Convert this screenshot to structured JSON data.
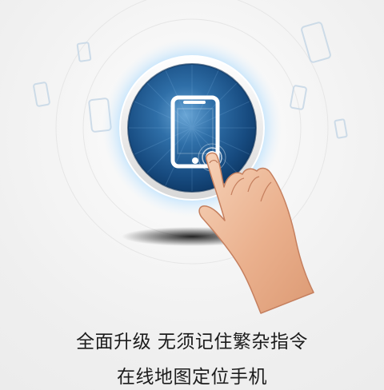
{
  "caption": {
    "line1": "全面升级 无须记住繁杂指令",
    "line2": "在线地图定位手机"
  },
  "colors": {
    "background": "#efefef",
    "glow": "#5fb8ff",
    "button_dark": "#0f3a68",
    "button_mid": "#2d6aa6",
    "caption_text": "#1c1c1c"
  },
  "icons": [
    "phone-icon",
    "pointing-hand-icon",
    "tap-ripple-icon",
    "floating-phone-icon"
  ]
}
